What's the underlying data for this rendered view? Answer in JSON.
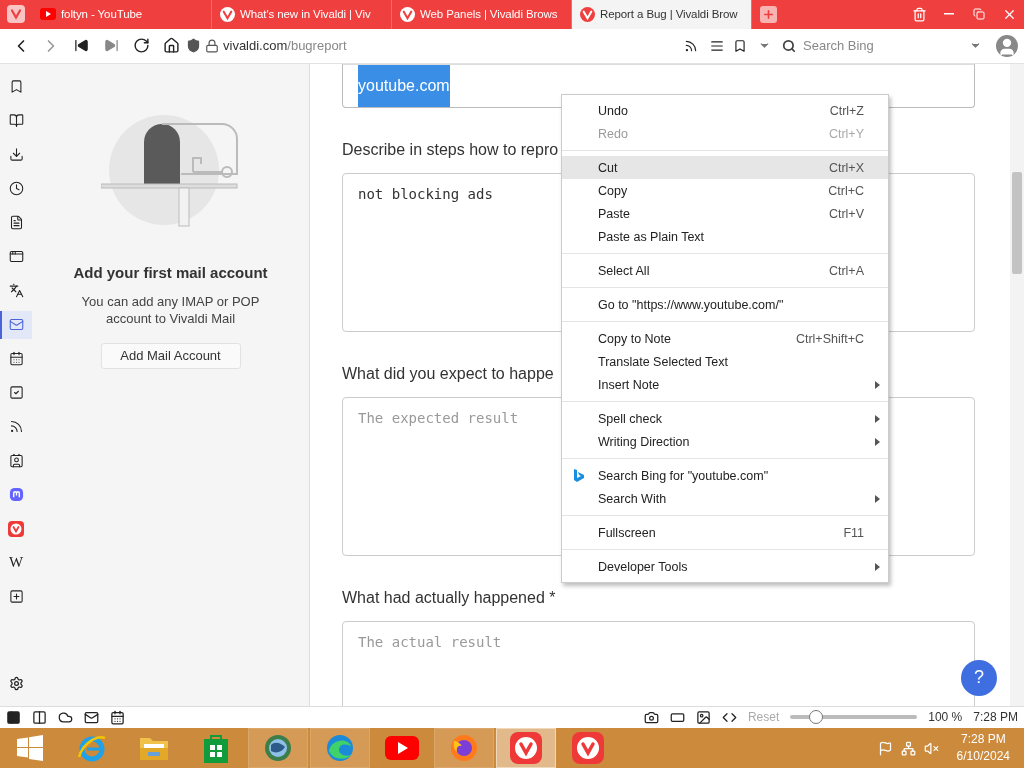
{
  "tabs": [
    {
      "title": "foltyn - YouTube",
      "kind": "youtube",
      "selected": false
    },
    {
      "title": "What's new in Vivaldi | Viv",
      "kind": "vivaldi",
      "selected": false
    },
    {
      "title": "Web Panels | Vivaldi Brows",
      "kind": "vivaldi",
      "selected": false
    },
    {
      "title": "Report a Bug | Vivaldi Brow",
      "kind": "vivaldi",
      "selected": true
    }
  ],
  "address_bar": {
    "url_host": "vivaldi.com",
    "url_path": "/bugreport",
    "search": {
      "placeholder": "Search Bing"
    }
  },
  "side_panel": {
    "items": [
      {
        "kind": "bookmarks",
        "selected": false
      },
      {
        "kind": "reading-list",
        "selected": false
      },
      {
        "kind": "downloads",
        "selected": false
      },
      {
        "kind": "history",
        "selected": false
      },
      {
        "kind": "notes",
        "selected": false
      },
      {
        "kind": "window",
        "selected": false
      },
      {
        "kind": "translate",
        "selected": false
      },
      {
        "kind": "mail",
        "selected": true
      },
      {
        "kind": "calendar",
        "selected": false
      },
      {
        "kind": "tasks",
        "selected": false
      },
      {
        "kind": "feeds",
        "selected": false
      },
      {
        "kind": "contacts",
        "selected": false
      },
      {
        "kind": "mastodon",
        "selected": false
      },
      {
        "kind": "vivaldi",
        "selected": false
      },
      {
        "kind": "wiki",
        "label": "W",
        "selected": false
      },
      {
        "kind": "add",
        "selected": false
      }
    ],
    "heading": "Add your first mail account",
    "text": "You can add any IMAP or POP account to Vivaldi Mail",
    "button": "Add Mail Account"
  },
  "page": {
    "form": [
      {
        "kind": "input",
        "value": "youtube.com",
        "text_selected": true
      },
      {
        "kind": "label",
        "text": "Describe in steps how to repro"
      },
      {
        "kind": "textarea",
        "value": "not blocking ads"
      },
      {
        "kind": "label",
        "text": "What did you expect to happe"
      },
      {
        "kind": "textarea",
        "placeholder": "The expected result"
      },
      {
        "kind": "label",
        "text": "What had actually happened *"
      },
      {
        "kind": "textarea",
        "placeholder": "The actual result"
      }
    ],
    "help_button": "?"
  },
  "context_menu": {
    "groups": [
      [
        {
          "label": "Undo",
          "shortcut": "Ctrl+Z",
          "disabled": false,
          "highlighted": false,
          "submenu": false
        },
        {
          "label": "Redo",
          "shortcut": "Ctrl+Y",
          "disabled": true,
          "highlighted": false,
          "submenu": false
        }
      ],
      [
        {
          "label": "Cut",
          "shortcut": "Ctrl+X",
          "disabled": false,
          "highlighted": true,
          "submenu": false
        },
        {
          "label": "Copy",
          "shortcut": "Ctrl+C",
          "disabled": false,
          "highlighted": false,
          "submenu": false
        },
        {
          "label": "Paste",
          "shortcut": "Ctrl+V",
          "disabled": false,
          "highlighted": false,
          "submenu": false
        },
        {
          "label": "Paste as Plain Text",
          "disabled": false,
          "highlighted": false,
          "submenu": false
        }
      ],
      [
        {
          "label": "Select All",
          "shortcut": "Ctrl+A",
          "disabled": false,
          "highlighted": false,
          "submenu": false
        }
      ],
      [
        {
          "label": "Go to \"https://www.youtube.com/\"",
          "disabled": false,
          "highlighted": false,
          "submenu": false
        }
      ],
      [
        {
          "label": "Copy to Note",
          "shortcut": "Ctrl+Shift+C",
          "disabled": false,
          "highlighted": false,
          "submenu": false
        },
        {
          "label": "Translate Selected Text",
          "disabled": false,
          "highlighted": false,
          "submenu": false
        },
        {
          "label": "Insert Note",
          "disabled": false,
          "highlighted": false,
          "submenu": true
        }
      ],
      [
        {
          "label": "Spell check",
          "disabled": false,
          "highlighted": false,
          "submenu": true
        },
        {
          "label": "Writing Direction",
          "disabled": false,
          "highlighted": false,
          "submenu": true
        }
      ],
      [
        {
          "label": "Search Bing for \"youtube.com\"",
          "kind": "web-search",
          "disabled": false,
          "highlighted": false,
          "submenu": false
        },
        {
          "label": "Search With",
          "disabled": false,
          "highlighted": false,
          "submenu": true
        }
      ],
      [
        {
          "label": "Fullscreen",
          "shortcut": "F11",
          "disabled": false,
          "highlighted": false,
          "submenu": false
        }
      ],
      [
        {
          "label": "Developer Tools",
          "disabled": false,
          "highlighted": false,
          "submenu": true
        }
      ]
    ]
  },
  "status_bar": {
    "reset": {
      "label": "Reset",
      "disabled": true
    },
    "zoom": {
      "level": 0.2,
      "reading": "100 %"
    },
    "clock": "7:28 PM"
  },
  "taskbar": {
    "items": [
      {
        "kind": "start",
        "running": false,
        "selected": false
      },
      {
        "kind": "ie",
        "running": false,
        "selected": false
      },
      {
        "kind": "explorer",
        "running": false,
        "selected": false
      },
      {
        "kind": "store",
        "running": false,
        "selected": false
      },
      {
        "kind": "globe",
        "running": true,
        "selected": false
      },
      {
        "kind": "edge",
        "running": true,
        "selected": false
      },
      {
        "kind": "youtube",
        "running": false,
        "selected": false
      },
      {
        "kind": "firefox",
        "running": true,
        "selected": false
      },
      {
        "kind": "vivaldi",
        "running": true,
        "selected": true
      },
      {
        "kind": "vivaldi",
        "running": false,
        "selected": false
      }
    ],
    "time": "7:28 PM",
    "date": "6/10/2024"
  }
}
